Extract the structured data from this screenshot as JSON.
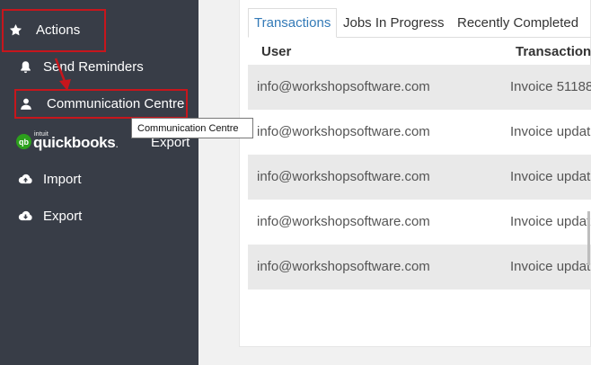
{
  "sidebar": {
    "items": [
      {
        "label": "Actions",
        "icon": "star-icon"
      },
      {
        "label": "Send Reminders",
        "icon": "bell-icon"
      },
      {
        "label": "Communication Centre",
        "icon": "user-icon"
      },
      {
        "label": "Import",
        "icon": "cloud-upload-icon"
      },
      {
        "label": "Export",
        "icon": "cloud-download-icon"
      }
    ],
    "quickbooks": {
      "intuit": "intuit",
      "logo_text": "qb",
      "brand": "quickbooks",
      "suffix": ".",
      "action": "Export"
    }
  },
  "tooltip": {
    "text": "Communication Centre"
  },
  "tabs": [
    {
      "label": "Transactions",
      "active": true
    },
    {
      "label": "Jobs In Progress",
      "active": false
    },
    {
      "label": "Recently Completed",
      "active": false
    }
  ],
  "table": {
    "columns": [
      "User",
      "Transaction"
    ],
    "rows": [
      {
        "user": "info@workshopsoftware.com",
        "transaction": "Invoice 51188"
      },
      {
        "user": "info@workshopsoftware.com",
        "transaction": "Invoice updat"
      },
      {
        "user": "info@workshopsoftware.com",
        "transaction": "Invoice updat"
      },
      {
        "user": "info@workshopsoftware.com",
        "transaction": "Invoice updat"
      },
      {
        "user": "info@workshopsoftware.com",
        "transaction": "Invoice updat"
      }
    ]
  },
  "colors": {
    "sidebar_bg": "#383d47",
    "highlight": "#c7161c",
    "tab_active": "#337ab7",
    "quickbooks_green": "#2ca01c"
  }
}
